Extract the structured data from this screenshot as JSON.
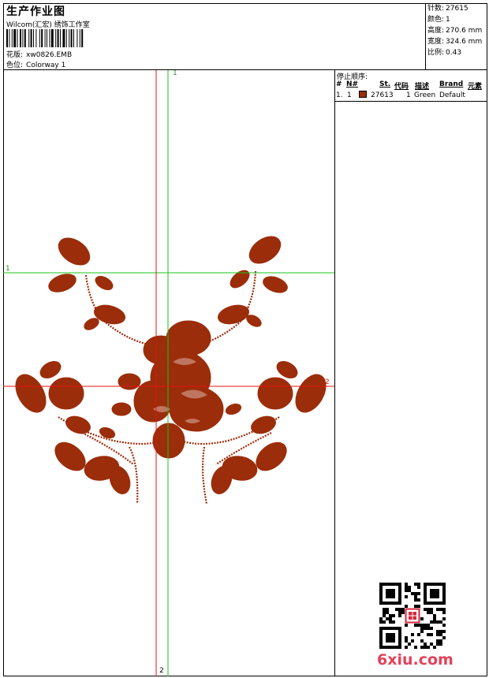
{
  "header": {
    "title": "生产作业图",
    "company": "Wilcom(汇宏) 绣饰工作室",
    "design_label": "花版:",
    "design_value": "xw0826.EMB",
    "colorway_label": "色位:",
    "colorway_value": "Colorway 1"
  },
  "stats": [
    {
      "label": "针数:",
      "value": "27615"
    },
    {
      "label": "颜色:",
      "value": "1"
    },
    {
      "label": "高度:",
      "value": "270.6 mm"
    },
    {
      "label": "宽度:",
      "value": "324.6 mm"
    },
    {
      "label": "比例:",
      "value": "0.43"
    }
  ],
  "guides": {
    "green_v": "1",
    "green_h": "1",
    "red_v": "2",
    "red_h": "2"
  },
  "stop_sequence": {
    "title": "停止顺序:",
    "headers": [
      "#",
      "N#",
      "St.",
      "代码",
      "描述",
      "Brand",
      "元素"
    ],
    "rows": [
      {
        "num": "1.",
        "needle": "1",
        "stitches": "27613",
        "code": "1",
        "desc": "Green",
        "brand": "Default",
        "element": "",
        "color": "#9b2d0a"
      }
    ]
  },
  "design_color": "#9b2d0a",
  "watermark": {
    "text": "6xiu.com",
    "color": "#e3425a"
  }
}
